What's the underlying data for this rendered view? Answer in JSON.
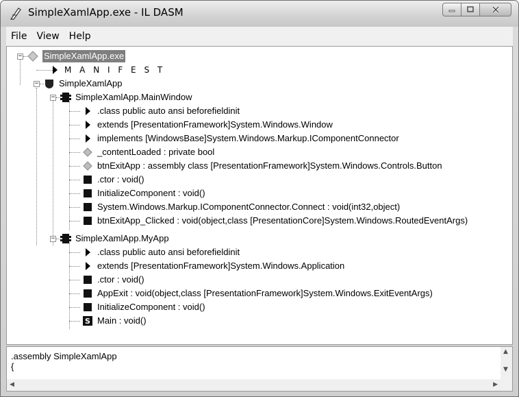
{
  "window": {
    "title": "SimpleXamlApp.exe - IL DASM"
  },
  "menu": [
    "File",
    "View",
    "Help"
  ],
  "tree": [
    {
      "label": "SimpleXamlApp.exe",
      "icon": "diamond-icon"
    },
    {
      "label": "M A N I F E S T",
      "icon": "triangle-icon"
    },
    {
      "label": "SimpleXamlApp",
      "icon": "shield-icon"
    },
    {
      "label": "SimpleXamlApp.MainWindow",
      "icon": "class-icon"
    },
    {
      "label": ".class public auto ansi beforefieldinit",
      "icon": "triangle-icon"
    },
    {
      "label": "extends [PresentationFramework]System.Windows.Window",
      "icon": "triangle-icon"
    },
    {
      "label": "implements [WindowsBase]System.Windows.Markup.IComponentConnector",
      "icon": "triangle-icon"
    },
    {
      "label": "_contentLoaded : private bool",
      "icon": "field-icon"
    },
    {
      "label": "btnExitApp : assembly class [PresentationFramework]System.Windows.Controls.Button",
      "icon": "field-icon"
    },
    {
      "label": ".ctor : void()",
      "icon": "method-icon"
    },
    {
      "label": "InitializeComponent : void()",
      "icon": "method-icon"
    },
    {
      "label": "System.Windows.Markup.IComponentConnector.Connect : void(int32,object)",
      "icon": "method-icon"
    },
    {
      "label": "btnExitApp_Clicked : void(object,class [PresentationCore]System.Windows.RoutedEventArgs)",
      "icon": "method-icon"
    },
    {
      "label": "SimpleXamlApp.MyApp",
      "icon": "class-icon"
    },
    {
      "label": ".class public auto ansi beforefieldinit",
      "icon": "triangle-icon"
    },
    {
      "label": "extends [PresentationFramework]System.Windows.Application",
      "icon": "triangle-icon"
    },
    {
      "label": ".ctor : void()",
      "icon": "method-icon"
    },
    {
      "label": "AppExit : void(object,class [PresentationFramework]System.Windows.ExitEventArgs)",
      "icon": "method-icon"
    },
    {
      "label": "InitializeComponent : void()",
      "icon": "method-icon"
    },
    {
      "label": "Main : void()",
      "icon": "static-method-icon",
      "badge": "S"
    }
  ],
  "bottom": {
    "line1": ".assembly SimpleXamlApp",
    "line2": "{"
  }
}
